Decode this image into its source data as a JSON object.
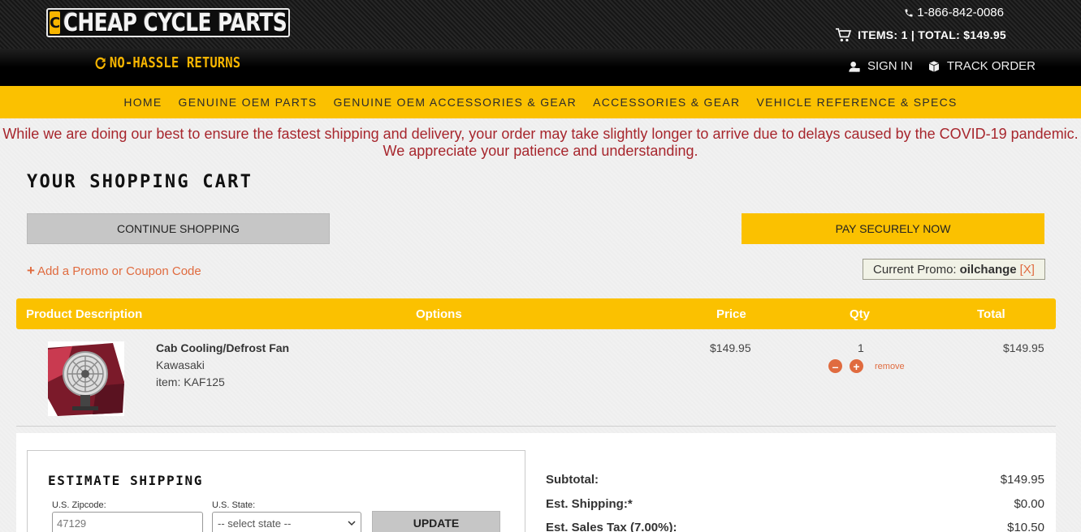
{
  "header": {
    "logo_badge": "C",
    "logo_text": "CHEAP CYCLE PARTS",
    "phone": "1-866-842-0086",
    "cart_summary": "ITEMS: 1 | TOTAL: $149.95",
    "returns": "NO-HASSLE RETURNS",
    "sign_in": "SIGN IN",
    "track_order": "TRACK ORDER"
  },
  "nav": {
    "items": [
      "HOME",
      "GENUINE OEM PARTS",
      "GENUINE OEM ACCESSORIES & GEAR",
      "ACCESSORIES & GEAR",
      "VEHICLE REFERENCE & SPECS"
    ]
  },
  "notice": {
    "line1": "While we are doing our best to ensure the fastest shipping and delivery, your order may take slightly longer to arrive due to delays caused by the COVID-19 pandemic.",
    "line2": "We appreciate your patience and understanding."
  },
  "cart": {
    "title": "YOUR SHOPPING CART",
    "continue_label": "CONTINUE SHOPPING",
    "pay_label": "PAY SECURELY NOW",
    "promo_link": "Add a Promo or Coupon Code",
    "current_promo_label": "Current Promo:",
    "current_promo_code": "oilchange",
    "current_promo_remove": "[X]",
    "columns": {
      "description": "Product Description",
      "options": "Options",
      "price": "Price",
      "qty": "Qty",
      "total": "Total"
    },
    "items": [
      {
        "name": "Cab Cooling/Defrost Fan",
        "brand": "Kawasaki",
        "sku": "item: KAF125",
        "price": "$149.95",
        "qty": "1",
        "total": "$149.95",
        "remove_label": "remove"
      }
    ]
  },
  "shipping": {
    "title": "ESTIMATE SHIPPING",
    "zip_label": "U.S. Zipcode:",
    "zip_value": "47129",
    "state_label": "U.S. State:",
    "state_placeholder": "-- select state --",
    "update_label": "UPDATE"
  },
  "totals": {
    "subtotal_label": "Subtotal:",
    "subtotal_value": "$149.95",
    "shipping_label": "Est. Shipping:*",
    "shipping_value": "$0.00",
    "tax_label": "Est. Sales Tax (7.00%):",
    "tax_value": "$10.50"
  },
  "colors": {
    "accent_yellow": "#fbc100",
    "link_orange": "#e06b3f",
    "notice_red": "#a7262d"
  }
}
